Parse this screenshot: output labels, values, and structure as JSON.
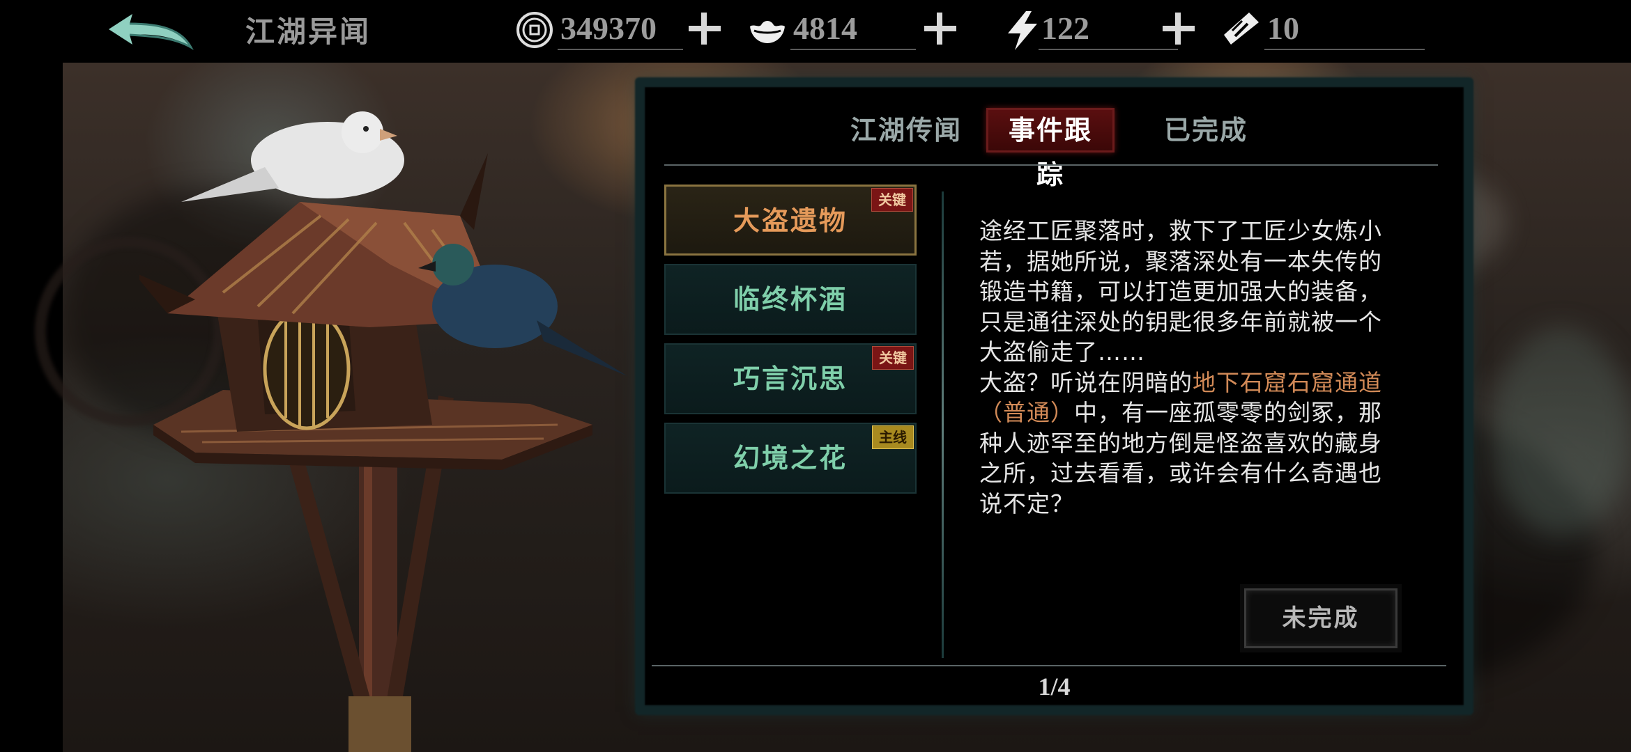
{
  "topbar": {
    "title": "江湖异闻",
    "resources": [
      {
        "icon": "coin-icon",
        "value": "349370"
      },
      {
        "icon": "silver-ingot-icon",
        "value": "4814"
      },
      {
        "icon": "lightning-icon",
        "value": "122"
      },
      {
        "icon": "scroll-ticket-icon",
        "value": "10"
      }
    ]
  },
  "tabs": [
    {
      "label": "江湖传闻",
      "active": false
    },
    {
      "label": "事件跟踪",
      "active": true
    },
    {
      "label": "已完成",
      "active": false
    }
  ],
  "quests": [
    {
      "title": "大盗遗物",
      "badge": "关键",
      "badge_type": "key",
      "selected": true
    },
    {
      "title": "临终杯酒",
      "badge": "",
      "badge_type": "",
      "selected": false
    },
    {
      "title": "巧言沉思",
      "badge": "关键",
      "badge_type": "key",
      "selected": false
    },
    {
      "title": "幻境之花",
      "badge": "主线",
      "badge_type": "main",
      "selected": false
    }
  ],
  "detail": {
    "text_1": "途经工匠聚落时，救下了工匠少女炼小若，据她所说，聚落深处有一本失传的锻造书籍，可以打造更加强大的装备，只是通往深处的钥匙很多年前就被一个大盗偷走了……",
    "text_2": "大盗？听说在阴暗的",
    "highlight": "地下石窟石窟通道（普通）",
    "text_3": "中，有一座孤零零的剑冢，那种人迹罕至的地方倒是怪盗喜欢的藏身之所，过去看看，或许会有什么奇遇也说不定？",
    "status_label": "未完成"
  },
  "pager": "1/4",
  "colors": {
    "accent_red": "#5b0f10",
    "quest_text": "#7fcfaa",
    "selected_quest_text": "#e59a5a",
    "highlight_text": "#d28a57"
  }
}
